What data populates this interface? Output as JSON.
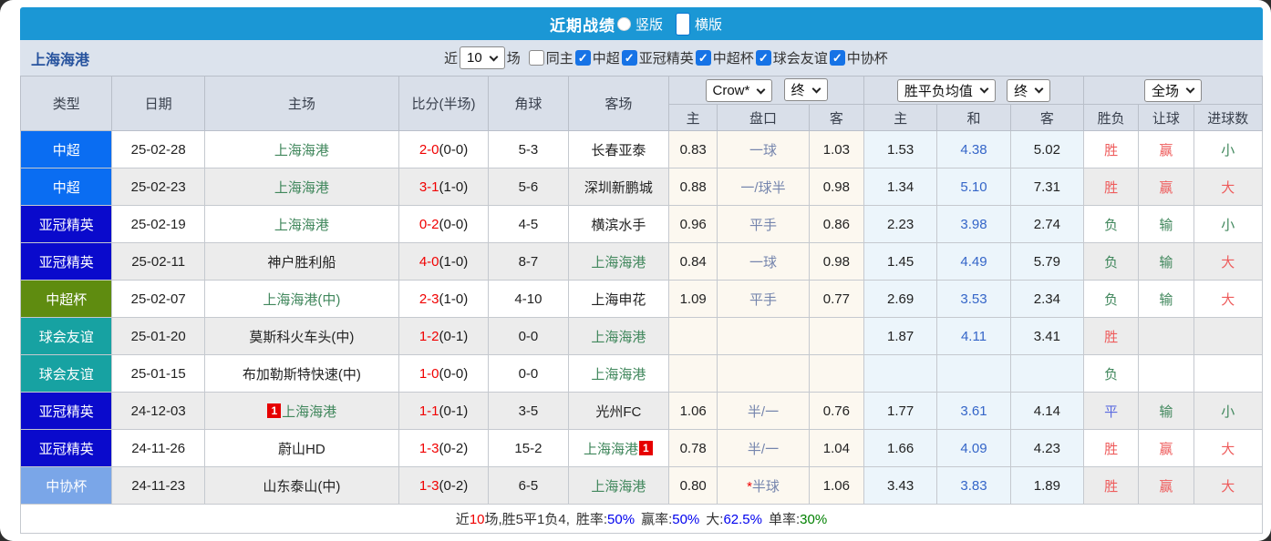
{
  "titlebar": {
    "title": "近期战绩",
    "radio_vertical": "竖版",
    "radio_horizontal": "横版",
    "selected": "横版"
  },
  "filterbar": {
    "team": "上海海港",
    "near_label": "近",
    "count_value": "10",
    "games_label": "场",
    "same_home_label": "同主",
    "leagues": [
      "中超",
      "亚冠精英",
      "中超杯",
      "球会友谊",
      "中协杯"
    ]
  },
  "table": {
    "headers": {
      "type": "类型",
      "date": "日期",
      "home": "主场",
      "score": "比分(半场)",
      "corner": "角球",
      "away": "客场"
    },
    "dropdowns": {
      "company": "Crow*",
      "company_time": "终",
      "avg": "胜平负均值",
      "avg_time": "终",
      "scope": "全场"
    },
    "subheaders": {
      "odds_home": "主",
      "odds_line": "盘口",
      "odds_away": "客",
      "avg_home": "主",
      "avg_draw": "和",
      "avg_away": "客",
      "result_wdl": "胜负",
      "result_handicap": "让球",
      "result_goals": "进球数"
    },
    "rows": [
      {
        "type": {
          "label": "中超",
          "cls": "t-csl"
        },
        "date": "25-02-28",
        "home": {
          "card_pre": "",
          "name": "上海海港",
          "cls": "green",
          "card_post": ""
        },
        "score": {
          "ft": "2-0",
          "half": "(0-0)"
        },
        "corner": "5-3",
        "away": {
          "card_pre": "",
          "name": "长春亚泰",
          "cls": "",
          "card_post": ""
        },
        "hcp": {
          "home": "0.83",
          "star": "",
          "line": "一球",
          "away": "1.03"
        },
        "avg": {
          "home": "1.53",
          "draw": "4.38",
          "away": "5.02"
        },
        "res": {
          "wdl": {
            "t": "胜",
            "c": "red"
          },
          "hcp": {
            "t": "赢",
            "c": "red"
          },
          "ou": {
            "t": "小",
            "c": "green"
          }
        }
      },
      {
        "type": {
          "label": "中超",
          "cls": "t-csl"
        },
        "date": "25-02-23",
        "home": {
          "card_pre": "",
          "name": "上海海港",
          "cls": "green",
          "card_post": ""
        },
        "score": {
          "ft": "3-1",
          "half": "(1-0)"
        },
        "corner": "5-6",
        "away": {
          "card_pre": "",
          "name": "深圳新鹏城",
          "cls": "",
          "card_post": ""
        },
        "hcp": {
          "home": "0.88",
          "star": "",
          "line": "一/球半",
          "away": "0.98"
        },
        "avg": {
          "home": "1.34",
          "draw": "5.10",
          "away": "7.31"
        },
        "res": {
          "wdl": {
            "t": "胜",
            "c": "red"
          },
          "hcp": {
            "t": "赢",
            "c": "red"
          },
          "ou": {
            "t": "大",
            "c": "red"
          }
        }
      },
      {
        "type": {
          "label": "亚冠精英",
          "cls": "t-acl"
        },
        "date": "25-02-19",
        "home": {
          "card_pre": "",
          "name": "上海海港",
          "cls": "green",
          "card_post": ""
        },
        "score": {
          "ft": "0-2",
          "half": "(0-0)"
        },
        "corner": "4-5",
        "away": {
          "card_pre": "",
          "name": "横滨水手",
          "cls": "",
          "card_post": ""
        },
        "hcp": {
          "home": "0.96",
          "star": "",
          "line": "平手",
          "away": "0.86"
        },
        "avg": {
          "home": "2.23",
          "draw": "3.98",
          "away": "2.74"
        },
        "res": {
          "wdl": {
            "t": "负",
            "c": "green"
          },
          "hcp": {
            "t": "输",
            "c": "green"
          },
          "ou": {
            "t": "小",
            "c": "green"
          }
        }
      },
      {
        "type": {
          "label": "亚冠精英",
          "cls": "t-acl"
        },
        "date": "25-02-11",
        "home": {
          "card_pre": "",
          "name": "神户胜利船",
          "cls": "",
          "card_post": ""
        },
        "score": {
          "ft": "4-0",
          "half": "(1-0)"
        },
        "corner": "8-7",
        "away": {
          "card_pre": "",
          "name": "上海海港",
          "cls": "green",
          "card_post": ""
        },
        "hcp": {
          "home": "0.84",
          "star": "",
          "line": "一球",
          "away": "0.98"
        },
        "avg": {
          "home": "1.45",
          "draw": "4.49",
          "away": "5.79"
        },
        "res": {
          "wdl": {
            "t": "负",
            "c": "green"
          },
          "hcp": {
            "t": "输",
            "c": "green"
          },
          "ou": {
            "t": "大",
            "c": "red"
          }
        }
      },
      {
        "type": {
          "label": "中超杯",
          "cls": "t-cup"
        },
        "date": "25-02-07",
        "home": {
          "card_pre": "",
          "name": "上海海港(中)",
          "cls": "green",
          "card_post": ""
        },
        "score": {
          "ft": "2-3",
          "half": "(1-0)"
        },
        "corner": "4-10",
        "away": {
          "card_pre": "",
          "name": "上海申花",
          "cls": "",
          "card_post": ""
        },
        "hcp": {
          "home": "1.09",
          "star": "",
          "line": "平手",
          "away": "0.77"
        },
        "avg": {
          "home": "2.69",
          "draw": "3.53",
          "away": "2.34"
        },
        "res": {
          "wdl": {
            "t": "负",
            "c": "green"
          },
          "hcp": {
            "t": "输",
            "c": "green"
          },
          "ou": {
            "t": "大",
            "c": "red"
          }
        }
      },
      {
        "type": {
          "label": "球会友谊",
          "cls": "t-fri"
        },
        "date": "25-01-20",
        "home": {
          "card_pre": "",
          "name": "莫斯科火车头(中)",
          "cls": "",
          "card_post": ""
        },
        "score": {
          "ft": "1-2",
          "half": "(0-1)"
        },
        "corner": "0-0",
        "away": {
          "card_pre": "",
          "name": "上海海港",
          "cls": "green",
          "card_post": ""
        },
        "hcp": {
          "home": "",
          "star": "",
          "line": "",
          "away": ""
        },
        "avg": {
          "home": "1.87",
          "draw": "4.11",
          "away": "3.41"
        },
        "res": {
          "wdl": {
            "t": "胜",
            "c": "red"
          },
          "hcp": {
            "t": "",
            "c": ""
          },
          "ou": {
            "t": "",
            "c": ""
          }
        }
      },
      {
        "type": {
          "label": "球会友谊",
          "cls": "t-fri"
        },
        "date": "25-01-15",
        "home": {
          "card_pre": "",
          "name": "布加勒斯特快速(中)",
          "cls": "",
          "card_post": ""
        },
        "score": {
          "ft": "1-0",
          "half": "(0-0)"
        },
        "corner": "0-0",
        "away": {
          "card_pre": "",
          "name": "上海海港",
          "cls": "green",
          "card_post": ""
        },
        "hcp": {
          "home": "",
          "star": "",
          "line": "",
          "away": ""
        },
        "avg": {
          "home": "",
          "draw": "",
          "away": ""
        },
        "res": {
          "wdl": {
            "t": "负",
            "c": "green"
          },
          "hcp": {
            "t": "",
            "c": ""
          },
          "ou": {
            "t": "",
            "c": ""
          }
        }
      },
      {
        "type": {
          "label": "亚冠精英",
          "cls": "t-acl"
        },
        "date": "24-12-03",
        "home": {
          "card_pre": "1",
          "name": "上海海港",
          "cls": "green",
          "card_post": ""
        },
        "score": {
          "ft": "1-1",
          "half": "(0-1)"
        },
        "corner": "3-5",
        "away": {
          "card_pre": "",
          "name": "光州FC",
          "cls": "",
          "card_post": ""
        },
        "hcp": {
          "home": "1.06",
          "star": "",
          "line": "半/一",
          "away": "0.76"
        },
        "avg": {
          "home": "1.77",
          "draw": "3.61",
          "away": "4.14"
        },
        "res": {
          "wdl": {
            "t": "平",
            "c": "blue"
          },
          "hcp": {
            "t": "输",
            "c": "green"
          },
          "ou": {
            "t": "小",
            "c": "green"
          }
        }
      },
      {
        "type": {
          "label": "亚冠精英",
          "cls": "t-acl"
        },
        "date": "24-11-26",
        "home": {
          "card_pre": "",
          "name": "蔚山HD",
          "cls": "",
          "card_post": ""
        },
        "score": {
          "ft": "1-3",
          "half": "(0-2)"
        },
        "corner": "15-2",
        "away": {
          "card_pre": "",
          "name": "上海海港",
          "cls": "green",
          "card_post": "1"
        },
        "hcp": {
          "home": "0.78",
          "star": "",
          "line": "半/一",
          "away": "1.04"
        },
        "avg": {
          "home": "1.66",
          "draw": "4.09",
          "away": "4.23"
        },
        "res": {
          "wdl": {
            "t": "胜",
            "c": "red"
          },
          "hcp": {
            "t": "赢",
            "c": "red"
          },
          "ou": {
            "t": "大",
            "c": "red"
          }
        }
      },
      {
        "type": {
          "label": "中协杯",
          "cls": "t-cfa"
        },
        "date": "24-11-23",
        "home": {
          "card_pre": "",
          "name": "山东泰山(中)",
          "cls": "",
          "card_post": ""
        },
        "score": {
          "ft": "1-3",
          "half": "(0-2)"
        },
        "corner": "6-5",
        "away": {
          "card_pre": "",
          "name": "上海海港",
          "cls": "green",
          "card_post": ""
        },
        "hcp": {
          "home": "0.80",
          "star": "*",
          "line": "半球",
          "away": "1.06"
        },
        "avg": {
          "home": "3.43",
          "draw": "3.83",
          "away": "1.89"
        },
        "res": {
          "wdl": {
            "t": "胜",
            "c": "red"
          },
          "hcp": {
            "t": "赢",
            "c": "red"
          },
          "ou": {
            "t": "大",
            "c": "red"
          }
        }
      }
    ],
    "footer": {
      "prefix": "近",
      "count": "10",
      "record": "场,胜5平1负4,",
      "win_rate_label": "胜率:",
      "win_rate": "50%",
      "handicap_rate_label": "赢率:",
      "handicap_rate": "50%",
      "over_rate_label": "大:",
      "over_rate": "62.5%",
      "single_rate_label": "单率:",
      "single_rate": "30%"
    }
  }
}
